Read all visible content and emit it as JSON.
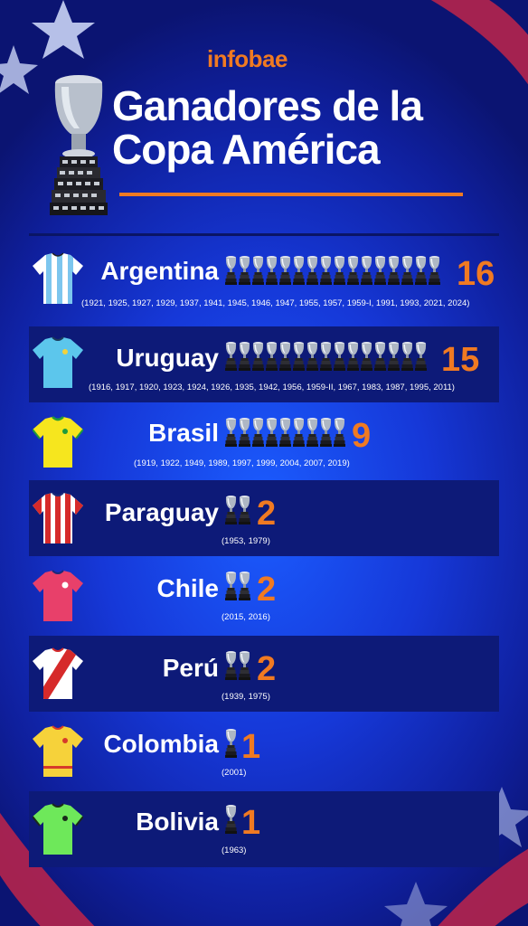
{
  "header": {
    "brand": "infobae",
    "title_line1": "Ganadores de la",
    "title_line2": "Copa América"
  },
  "colors": {
    "accent": "#f07a22",
    "background": "#1638d8",
    "row_dark": "#0d1a78"
  },
  "icons": {
    "trophy": "copa-america-trophy-icon",
    "shirt": "jersey-icon"
  },
  "winners": [
    {
      "name": "Argentina",
      "titles": "16",
      "title_count": 16,
      "years": "(1921, 1925, 1927, 1929, 1937, 1941, 1945, 1946, 1947, 1955, 1957, 1959-I, 1991, 1993, 2021, 2024)"
    },
    {
      "name": "Uruguay",
      "titles": "15",
      "title_count": 15,
      "years": "(1916, 1917, 1920, 1923, 1924, 1926, 1935, 1942, 1956, 1959-II, 1967, 1983, 1987, 1995, 2011)"
    },
    {
      "name": "Brasil",
      "titles": "9",
      "title_count": 9,
      "years": "(1919, 1922, 1949, 1989, 1997, 1999, 2004, 2007, 2019)"
    },
    {
      "name": "Paraguay",
      "titles": "2",
      "title_count": 2,
      "years": "(1953, 1979)"
    },
    {
      "name": "Chile",
      "titles": "2",
      "title_count": 2,
      "years": "(2015, 2016)"
    },
    {
      "name": "Perú",
      "titles": "2",
      "title_count": 2,
      "years": "(1939, 1975)"
    },
    {
      "name": "Colombia",
      "titles": "1",
      "title_count": 1,
      "years": "(2001)"
    },
    {
      "name": "Bolivia",
      "titles": "1",
      "title_count": 1,
      "years": "(1963)"
    }
  ]
}
